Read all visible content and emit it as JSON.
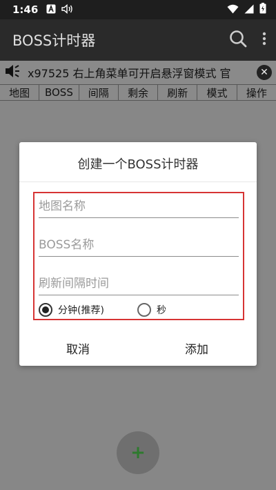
{
  "status_bar": {
    "time": "1:46"
  },
  "app_bar": {
    "title": "BOSS计时器"
  },
  "marquee": {
    "text": "x97525 右上角菜单可开启悬浮窗模式 官"
  },
  "table_header": {
    "columns": [
      "地图",
      "BOSS",
      "间隔",
      "剩余",
      "刷新",
      "模式",
      "操作"
    ]
  },
  "dialog": {
    "title": "创建一个BOSS计时器",
    "fields": {
      "map_name_placeholder": "地图名称",
      "boss_name_placeholder": "BOSS名称",
      "interval_placeholder": "刷新间隔时间"
    },
    "unit_options": {
      "minutes": "分钟(推荐)",
      "seconds": "秒",
      "selected": "minutes"
    },
    "cancel_label": "取消",
    "add_label": "添加"
  },
  "fab": {
    "icon": "plus-icon",
    "glyph": "+"
  },
  "colors": {
    "accent_red": "#d63333",
    "fab_plus": "#2e7a2e"
  }
}
